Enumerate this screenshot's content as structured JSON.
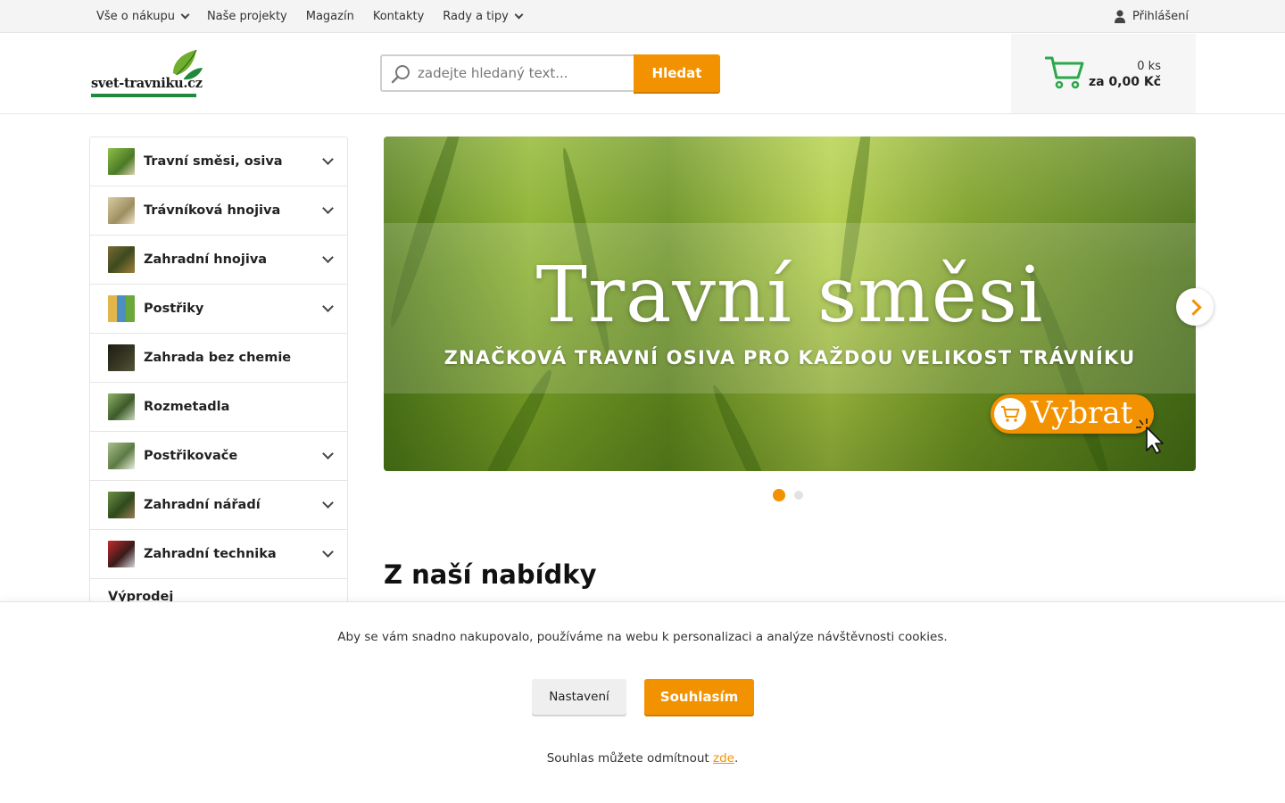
{
  "topnav": {
    "items": [
      {
        "label": "Vše o nákupu",
        "dropdown": true
      },
      {
        "label": "Naše projekty",
        "dropdown": false
      },
      {
        "label": "Magazín",
        "dropdown": false
      },
      {
        "label": "Kontakty",
        "dropdown": false
      },
      {
        "label": "Rady a tipy",
        "dropdown": true
      }
    ],
    "login_label": "Přihlášení"
  },
  "header": {
    "logo_text": "svet-travniku.cz",
    "search_placeholder": "zadejte hledaný text...",
    "search_button": "Hledat",
    "cart_qty": "0 ks",
    "cart_total": "za 0,00 Kč"
  },
  "sidebar": {
    "categories": [
      {
        "label": "Travní směsi, osiva",
        "expandable": true,
        "thumb_color": "#6a8f3a"
      },
      {
        "label": "Trávníková hnojiva",
        "expandable": true,
        "thumb_color": "#b9a77a"
      },
      {
        "label": "Zahradní hnojiva",
        "expandable": true,
        "thumb_color": "#6b5a2e"
      },
      {
        "label": "Postřiky",
        "expandable": true,
        "thumb_color": "#c4a84a"
      },
      {
        "label": "Zahrada bez chemie",
        "expandable": false,
        "thumb_color": "#2a2a1e"
      },
      {
        "label": "Rozmetadla",
        "expandable": false,
        "thumb_color": "#4e6b3a"
      },
      {
        "label": "Postřikovače",
        "expandable": true,
        "thumb_color": "#7f9a6a"
      },
      {
        "label": "Zahradní nářadí",
        "expandable": true,
        "thumb_color": "#4c6a34"
      },
      {
        "label": "Zahradní technika",
        "expandable": true,
        "thumb_color": "#8a2a2a"
      }
    ],
    "extra_link": "Výprodej"
  },
  "banner": {
    "title": "Travní směsi",
    "subtitle": "ZNAČKOVÁ TRAVNÍ OSIVA PRO KAŽDOU VELIKOST TRÁVNÍKU",
    "cta": "Vybrat",
    "slide_count": 2,
    "active_slide": 1
  },
  "main": {
    "section_title": "Z naší nabídky"
  },
  "cookie": {
    "message": "Aby se vám snadno nakupovalo, používáme na webu k personalizaci a analýze návštěvnosti cookies.",
    "settings_button": "Nastavení",
    "agree_button": "Souhlasím",
    "decline_prefix": "Souhlas můžete odmítnout ",
    "decline_link": "zde",
    "decline_suffix": "."
  },
  "colors": {
    "accent": "#f39200",
    "brand_green": "#1f8a3b",
    "cart_green": "#2aa84a"
  },
  "icons": {
    "login": "user-icon",
    "search": "search-icon",
    "cart": "cart-icon",
    "next": "chevron-right-icon"
  }
}
